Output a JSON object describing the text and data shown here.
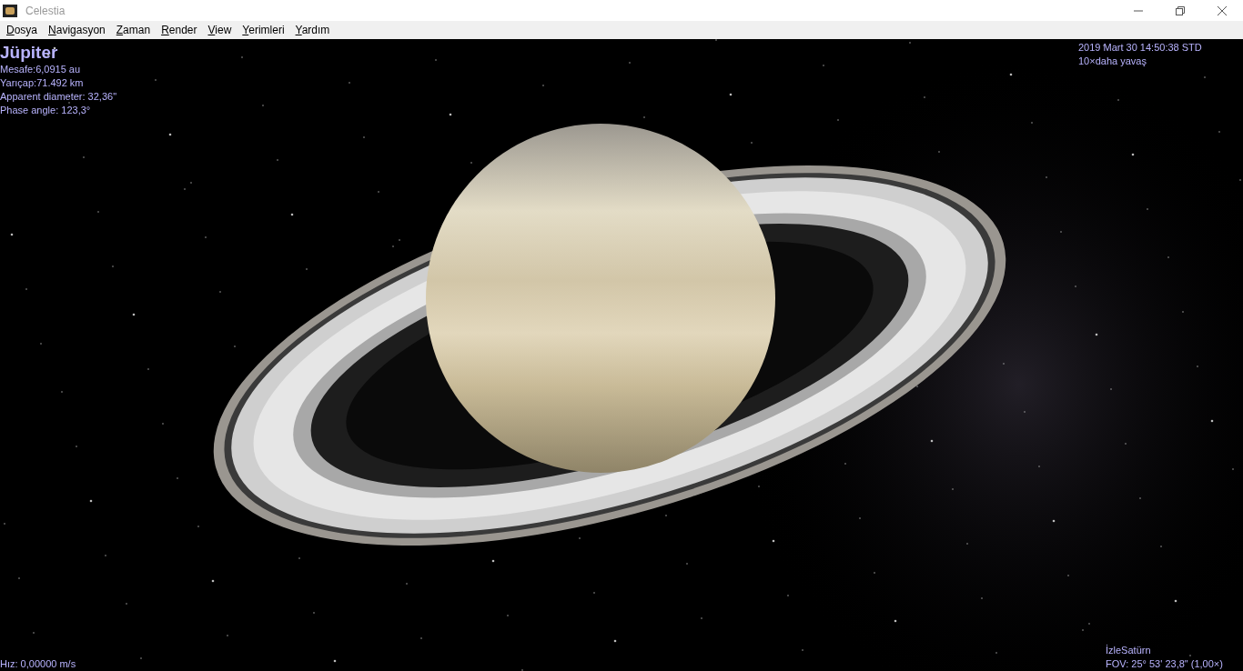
{
  "window": {
    "title": "Celestia"
  },
  "menu": [
    {
      "label": "Dosya"
    },
    {
      "label": "Navigasyon"
    },
    {
      "label": "Zaman"
    },
    {
      "label": "Render"
    },
    {
      "label": "View"
    },
    {
      "label": "Yerimleri"
    },
    {
      "label": "Yardım"
    }
  ],
  "hud": {
    "object_name": "Jüpiter",
    "info": [
      "Mesafe:6,0915 au",
      "Yarıçap:71.492 km",
      "Apparent diameter: 32,36\"",
      "Phase angle: 123,3°"
    ],
    "time": "2019 Mart 30 14:50:38 STD",
    "time_rate": "10×daha yavaş",
    "speed": "Hız: 0,00000 m/s",
    "follow": "İzleSatürn",
    "fov": "FOV: 25° 53' 23,8\" (1,00×)"
  }
}
